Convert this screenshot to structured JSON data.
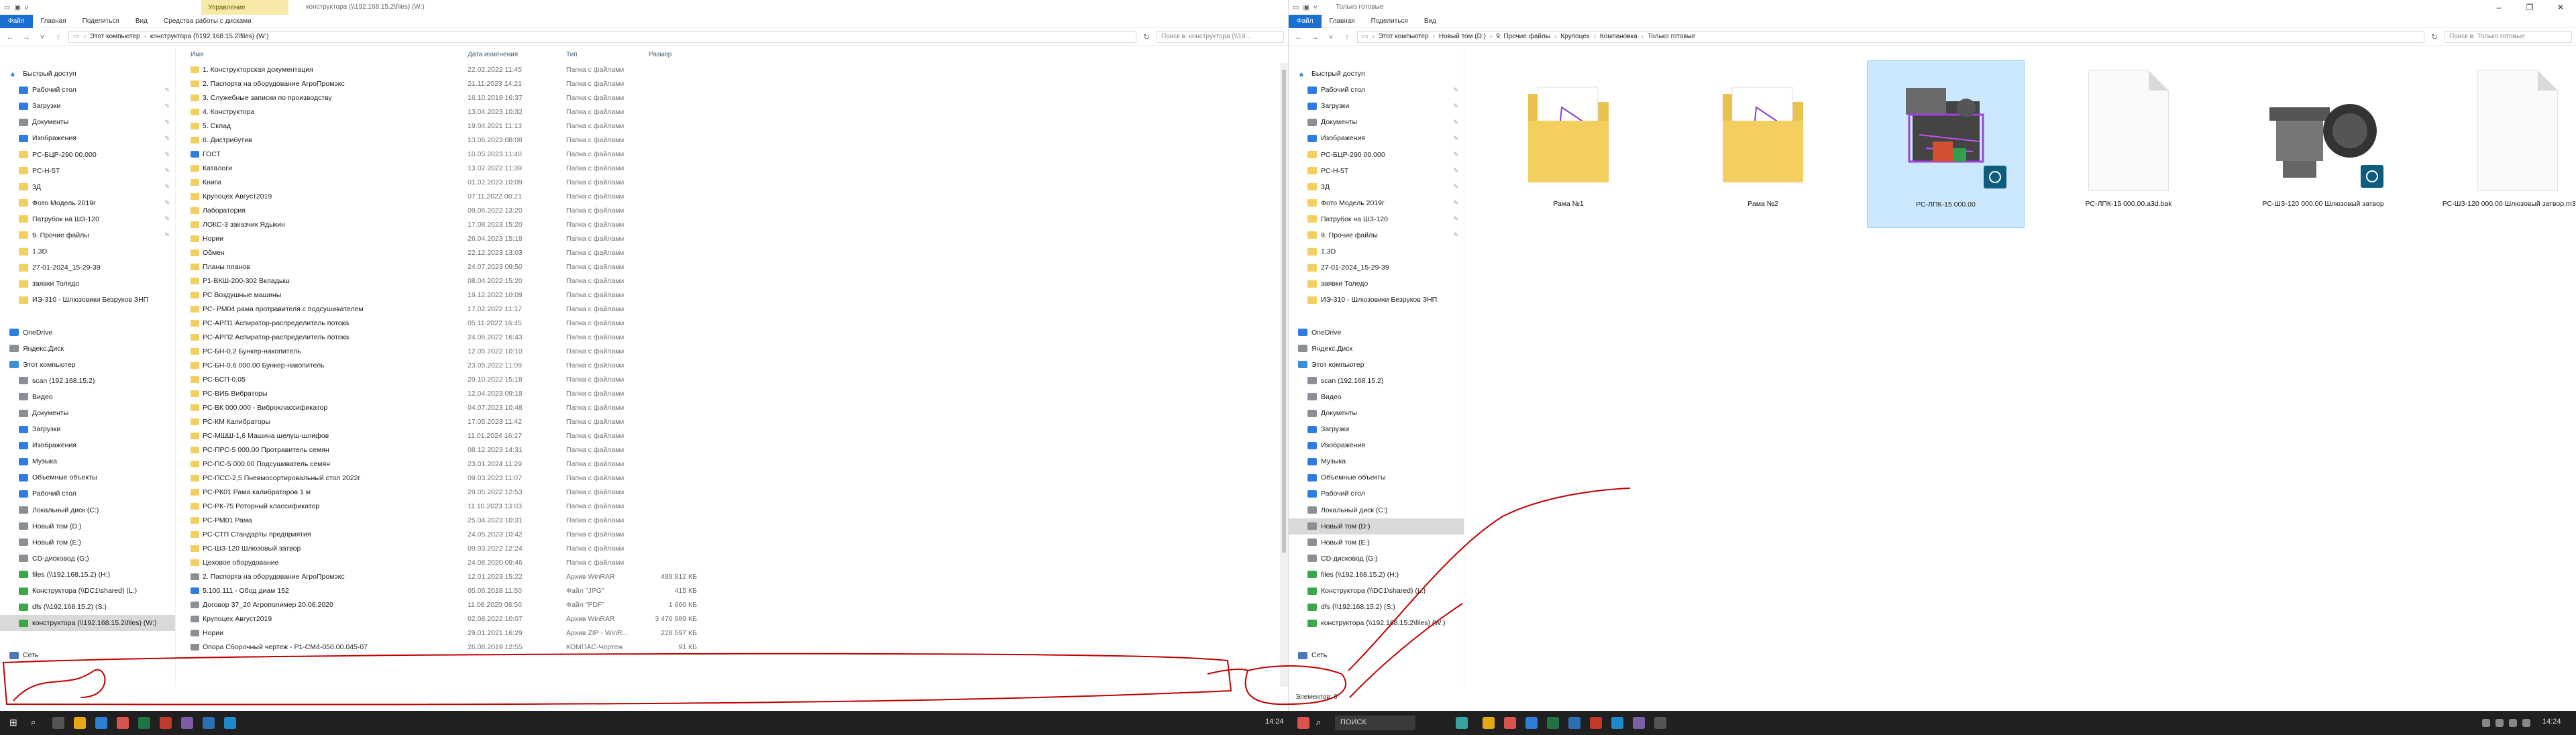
{
  "left_window": {
    "quick_access_label": "v",
    "context_tab": "Управление",
    "title": "конструктора (\\\\192.168.15.2\\files) (W:)",
    "ribbon_tabs": [
      "Файл",
      "Главная",
      "Поделиться",
      "Вид",
      "Средства работы с дисками"
    ],
    "breadcrumb": [
      "Этот компьютер",
      "конструктора (\\\\192.168.15.2\\files) (W:)"
    ],
    "search_placeholder": "Поиск в: конструктора (\\\\19...",
    "columns": {
      "name": "Имя",
      "date": "Дата изменения",
      "type": "Тип",
      "size": "Размер"
    },
    "files": [
      {
        "name": "1. Конструкторская документация",
        "date": "22.02.2022 11:45",
        "type": "Папка с файлами",
        "size": "",
        "kind": "folder"
      },
      {
        "name": "2. Паспорта на оборудование АгроПромэкс",
        "date": "21.11.2023 14:21",
        "type": "Папка с файлами",
        "size": "",
        "kind": "folder"
      },
      {
        "name": "3. Служебные записки по производству",
        "date": "16.10.2019 16:37",
        "type": "Папка с файлами",
        "size": "",
        "kind": "folder"
      },
      {
        "name": "4. Конструктора",
        "date": "13.04.2023 10:32",
        "type": "Папка с файлами",
        "size": "",
        "kind": "folder"
      },
      {
        "name": "5. Склад",
        "date": "19.04.2021 11:13",
        "type": "Папка с файлами",
        "size": "",
        "kind": "folder"
      },
      {
        "name": "6. Дистрибутив",
        "date": "13.06.2023 08:08",
        "type": "Папка с файлами",
        "size": "",
        "kind": "folder"
      },
      {
        "name": "ГОСТ",
        "date": "10.05.2023 11:40",
        "type": "Папка с файлами",
        "size": "",
        "kind": "special"
      },
      {
        "name": "Каталоги",
        "date": "13.02.2022 11:39",
        "type": "Папка с файлами",
        "size": "",
        "kind": "folder"
      },
      {
        "name": "Книги",
        "date": "01.02.2023 10:09",
        "type": "Папка с файлами",
        "size": "",
        "kind": "folder"
      },
      {
        "name": "Крупоцех Август2019",
        "date": "07.11.2022 08:21",
        "type": "Папка с файлами",
        "size": "",
        "kind": "folder"
      },
      {
        "name": "Лаборатория",
        "date": "09.06.2022 13:20",
        "type": "Папка с файлами",
        "size": "",
        "kind": "folder"
      },
      {
        "name": "ЛОКС-3 заказчик Ядыкин",
        "date": "17.08.2023 15:20",
        "type": "Папка с файлами",
        "size": "",
        "kind": "folder"
      },
      {
        "name": "Нории",
        "date": "26.04.2023 15:18",
        "type": "Папка с файлами",
        "size": "",
        "kind": "folder"
      },
      {
        "name": "Обмен",
        "date": "22.12.2023 13:03",
        "type": "Папка с файлами",
        "size": "",
        "kind": "folder"
      },
      {
        "name": "Планы планов",
        "date": "24.07.2023 09:50",
        "type": "Папка с файлами",
        "size": "",
        "kind": "folder"
      },
      {
        "name": "Р1-ВКШ-200-302 Вкладыш",
        "date": "08.04.2022 15:20",
        "type": "Папка с файлами",
        "size": "",
        "kind": "folder"
      },
      {
        "name": "РС Воздушные машины",
        "date": "19.12.2022 10:09",
        "type": "Папка с файлами",
        "size": "",
        "kind": "folder"
      },
      {
        "name": "РС- РМ04 рама протравителя с подсушивателем",
        "date": "17.02.2022 11:17",
        "type": "Папка с файлами",
        "size": "",
        "kind": "folder"
      },
      {
        "name": "РС-АРП1 Аспиратор-распределитель потока",
        "date": "05.11.2022 16:45",
        "type": "Папка с файлами",
        "size": "",
        "kind": "folder"
      },
      {
        "name": "РС-АРП2 Аспиратор-распределитель потока",
        "date": "24.06.2022 16:43",
        "type": "Папка с файлами",
        "size": "",
        "kind": "folder"
      },
      {
        "name": "РС-БН-0,2 Бункер-накопитель",
        "date": "12.05.2022 10:10",
        "type": "Папка с файлами",
        "size": "",
        "kind": "folder"
      },
      {
        "name": "РС-БН-0,6 000.00 Бункер-накопитель",
        "date": "23.05.2022 11:09",
        "type": "Папка с файлами",
        "size": "",
        "kind": "folder"
      },
      {
        "name": "РС-БСП-0,05",
        "date": "29.10.2022 15:18",
        "type": "Папка с файлами",
        "size": "",
        "kind": "folder"
      },
      {
        "name": "РС-ВИБ Вибраторы",
        "date": "12.04.2023 09:18",
        "type": "Папка с файлами",
        "size": "",
        "kind": "folder"
      },
      {
        "name": "РС-ВК 000.000 - Виброклассификатор",
        "date": "04.07.2023 10:48",
        "type": "Папка с файлами",
        "size": "",
        "kind": "folder"
      },
      {
        "name": "РС-КМ Калибраторы",
        "date": "17.05.2023 11:42",
        "type": "Папка с файлами",
        "size": "",
        "kind": "folder"
      },
      {
        "name": "РС-МШШ-1,6 Машина шелуш-шлифов",
        "date": "11.01.2024 16:17",
        "type": "Папка с файлами",
        "size": "",
        "kind": "folder"
      },
      {
        "name": "РС-ПРС-5 000.00 Протравитель семян",
        "date": "08.12.2023 14:31",
        "type": "Папка с файлами",
        "size": "",
        "kind": "folder"
      },
      {
        "name": "РС-ПС-5 000.00 Подсушиватель семян",
        "date": "23.01.2024 11:29",
        "type": "Папка с файлами",
        "size": "",
        "kind": "folder"
      },
      {
        "name": "РС-ПСС-2,5 Пневмосортировальный стол 2022г",
        "date": "09.03.2023 11:07",
        "type": "Папка с файлами",
        "size": "",
        "kind": "folder"
      },
      {
        "name": "РС-РК01 Рама калибраторов 1 м",
        "date": "29.05.2022 12:53",
        "type": "Папка с файлами",
        "size": "",
        "kind": "folder"
      },
      {
        "name": "РС-РК-75 Роторный классификатор",
        "date": "11.10.2023 13:03",
        "type": "Папка с файлами",
        "size": "",
        "kind": "folder"
      },
      {
        "name": "РС-РМ01 Рама",
        "date": "25.04.2023 10:31",
        "type": "Папка с файлами",
        "size": "",
        "kind": "folder"
      },
      {
        "name": "РС-СТП Стандарты предприятия",
        "date": "24.05.2023 10:42",
        "type": "Папка с файлами",
        "size": "",
        "kind": "folder"
      },
      {
        "name": "РС-ШЗ-120 Шлюзовый затвор",
        "date": "09.03.2022 12:24",
        "type": "Папка с файлами",
        "size": "",
        "kind": "folder"
      },
      {
        "name": "Цеховое оборудование",
        "date": "24.08.2020 09:46",
        "type": "Папка с файлами",
        "size": "",
        "kind": "folder"
      },
      {
        "name": "2. Паспорта на оборудование АгроПромэкс",
        "date": "12.01.2023 15:22",
        "type": "Архив WinRAR",
        "size": "489 812 КБ",
        "kind": "rar"
      },
      {
        "name": "5.100.111 - Обод диам 152",
        "date": "05.06.2018 11:50",
        "type": "Файл \"JPG\"",
        "size": "415 КБ",
        "kind": "jpg"
      },
      {
        "name": "Договор 37_20 Агрополимер 20.06.2020",
        "date": "11.06.2020 08:50",
        "type": "Файл \"PDF\"",
        "size": "1 660 КБ",
        "kind": "pdf"
      },
      {
        "name": "Крупоцех Август2019",
        "date": "02.08.2022 10:07",
        "type": "Архив WinRAR",
        "size": "3 476 989 КБ",
        "kind": "rar"
      },
      {
        "name": "Нории",
        "date": "29.01.2021 16:29",
        "type": "Архив ZIP - WinR...",
        "size": "228 597 КБ",
        "kind": "zip"
      },
      {
        "name": "Опора Сборочный чертеж - Р1-СМ4-050.00.045-07",
        "date": "26.08.2019 12:55",
        "type": "КОМПАС-Чертеж",
        "size": "91 КБ",
        "kind": "kompas"
      }
    ]
  },
  "right_window": {
    "title": "Только готовые",
    "ribbon_tabs": [
      "Файл",
      "Главная",
      "Поделиться",
      "Вид"
    ],
    "breadcrumb": [
      "Этот компьютер",
      "Новый том (D:)",
      "9. Прочие файлы",
      "Крупоцех",
      "Компановка",
      "Только готовые"
    ],
    "search_placeholder": "Поиск в: Только готовые",
    "items": [
      {
        "label": "Рама №1",
        "kind": "folder"
      },
      {
        "label": "Рама №2",
        "kind": "folder"
      },
      {
        "label": "РС-ЛПК-15 000.00",
        "kind": "model-selected"
      },
      {
        "label": "РС-ЛПК-15 000.00.a3d.bak",
        "kind": "doc"
      },
      {
        "label": "РС-ШЗ-120 000.00 Шлюзовый затвор",
        "kind": "model"
      },
      {
        "label": "РС-ШЗ-120 000.00 Шлюзовый затвор.m3d.bak",
        "kind": "doc"
      }
    ],
    "status": "Элементов: 6"
  },
  "nav_pane": [
    {
      "label": "Быстрый доступ",
      "icon": "star-icon",
      "level": 0,
      "pinned": false
    },
    {
      "label": "Рабочий стол",
      "icon": "desktop-icon",
      "level": 1,
      "pinned": true
    },
    {
      "label": "Загрузки",
      "icon": "download-icon",
      "level": 1,
      "pinned": true
    },
    {
      "label": "Документы",
      "icon": "documents-icon",
      "level": 1,
      "pinned": true
    },
    {
      "label": "Изображения",
      "icon": "pictures-icon",
      "level": 1,
      "pinned": true
    },
    {
      "label": "РС-БЦР-290 00.000",
      "icon": "folder-icon",
      "level": 1,
      "pinned": true
    },
    {
      "label": "РС-Н-5Т",
      "icon": "folder-icon",
      "level": 1,
      "pinned": true
    },
    {
      "label": "3Д",
      "icon": "folder-icon",
      "level": 1,
      "pinned": true
    },
    {
      "label": "Фото Модель 2019г",
      "icon": "folder-icon",
      "level": 1,
      "pinned": true
    },
    {
      "label": "Патрубок на ШЗ-120",
      "icon": "folder-icon",
      "level": 1,
      "pinned": true
    },
    {
      "label": "9. Прочие файлы",
      "icon": "folder-icon",
      "level": 1,
      "pinned": true
    },
    {
      "label": "1.3D",
      "icon": "folder-icon",
      "level": 1,
      "pinned": false
    },
    {
      "label": "27-01-2024_15-29-39",
      "icon": "folder-icon",
      "level": 1,
      "pinned": false
    },
    {
      "label": "заявки Толедо",
      "icon": "folder-icon",
      "level": 1,
      "pinned": false
    },
    {
      "label": "ИЭ-310 - Шлюзовики Безруков ЗНП",
      "icon": "folder-icon",
      "level": 1,
      "pinned": false
    },
    {
      "label": "",
      "icon": "",
      "level": 0,
      "pinned": false
    },
    {
      "label": "OneDrive",
      "icon": "onedrive-icon",
      "level": 0,
      "pinned": false
    },
    {
      "label": "Яндекс.Диск",
      "icon": "yandex-disk-icon",
      "level": 0,
      "pinned": false
    },
    {
      "label": "Этот компьютер",
      "icon": "computer-icon",
      "level": 0,
      "pinned": false
    },
    {
      "label": "scan (192.168.15.2)",
      "icon": "network-folder-icon",
      "level": 1,
      "pinned": false
    },
    {
      "label": "Видео",
      "icon": "video-icon",
      "level": 1,
      "pinned": false
    },
    {
      "label": "Документы",
      "icon": "documents-icon",
      "level": 1,
      "pinned": false
    },
    {
      "label": "Загрузки",
      "icon": "download-icon",
      "level": 1,
      "pinned": false
    },
    {
      "label": "Изображения",
      "icon": "pictures-icon",
      "level": 1,
      "pinned": false
    },
    {
      "label": "Музыка",
      "icon": "music-icon",
      "level": 1,
      "pinned": false
    },
    {
      "label": "Объемные объекты",
      "icon": "3d-objects-icon",
      "level": 1,
      "pinned": false
    },
    {
      "label": "Рабочий стол",
      "icon": "desktop-icon",
      "level": 1,
      "pinned": false
    },
    {
      "label": "Локальный диск (C:)",
      "icon": "drive-icon",
      "level": 1,
      "pinned": false
    },
    {
      "label": "Новый том (D:)",
      "icon": "drive-icon",
      "level": 1,
      "pinned": false
    },
    {
      "label": "Новый том (E:)",
      "icon": "drive-icon",
      "level": 1,
      "pinned": false
    },
    {
      "label": "CD-дисковод (G:)",
      "icon": "cd-icon",
      "level": 1,
      "pinned": false
    },
    {
      "label": "files (\\\\192.168.15.2) (H:)",
      "icon": "network-drive-icon",
      "level": 1,
      "pinned": false
    },
    {
      "label": "Конструктора (\\\\DC1\\shared) (L:)",
      "icon": "network-drive-icon",
      "level": 1,
      "pinned": false
    },
    {
      "label": "dfs (\\\\192.168.15.2) (S:)",
      "icon": "network-drive-icon",
      "level": 1,
      "pinned": false
    },
    {
      "label": "конструктора (\\\\192.168.15.2\\files) (W:)",
      "icon": "network-drive-icon",
      "level": 1,
      "pinned": false
    },
    {
      "label": "",
      "icon": "",
      "level": 0,
      "pinned": false
    },
    {
      "label": "Сеть",
      "icon": "network-icon",
      "level": 0,
      "pinned": false
    }
  ],
  "left_selected_nav": 34,
  "right_selected_nav": 28,
  "taskbar": {
    "left_clock": "14:24",
    "right_search": "ПОИСК",
    "right_clock": "14:24"
  },
  "colors": {
    "accent": "#1a6fd0",
    "annotation": "#c00000",
    "folder": "#f3cf60",
    "selection": "#cce8ff"
  }
}
